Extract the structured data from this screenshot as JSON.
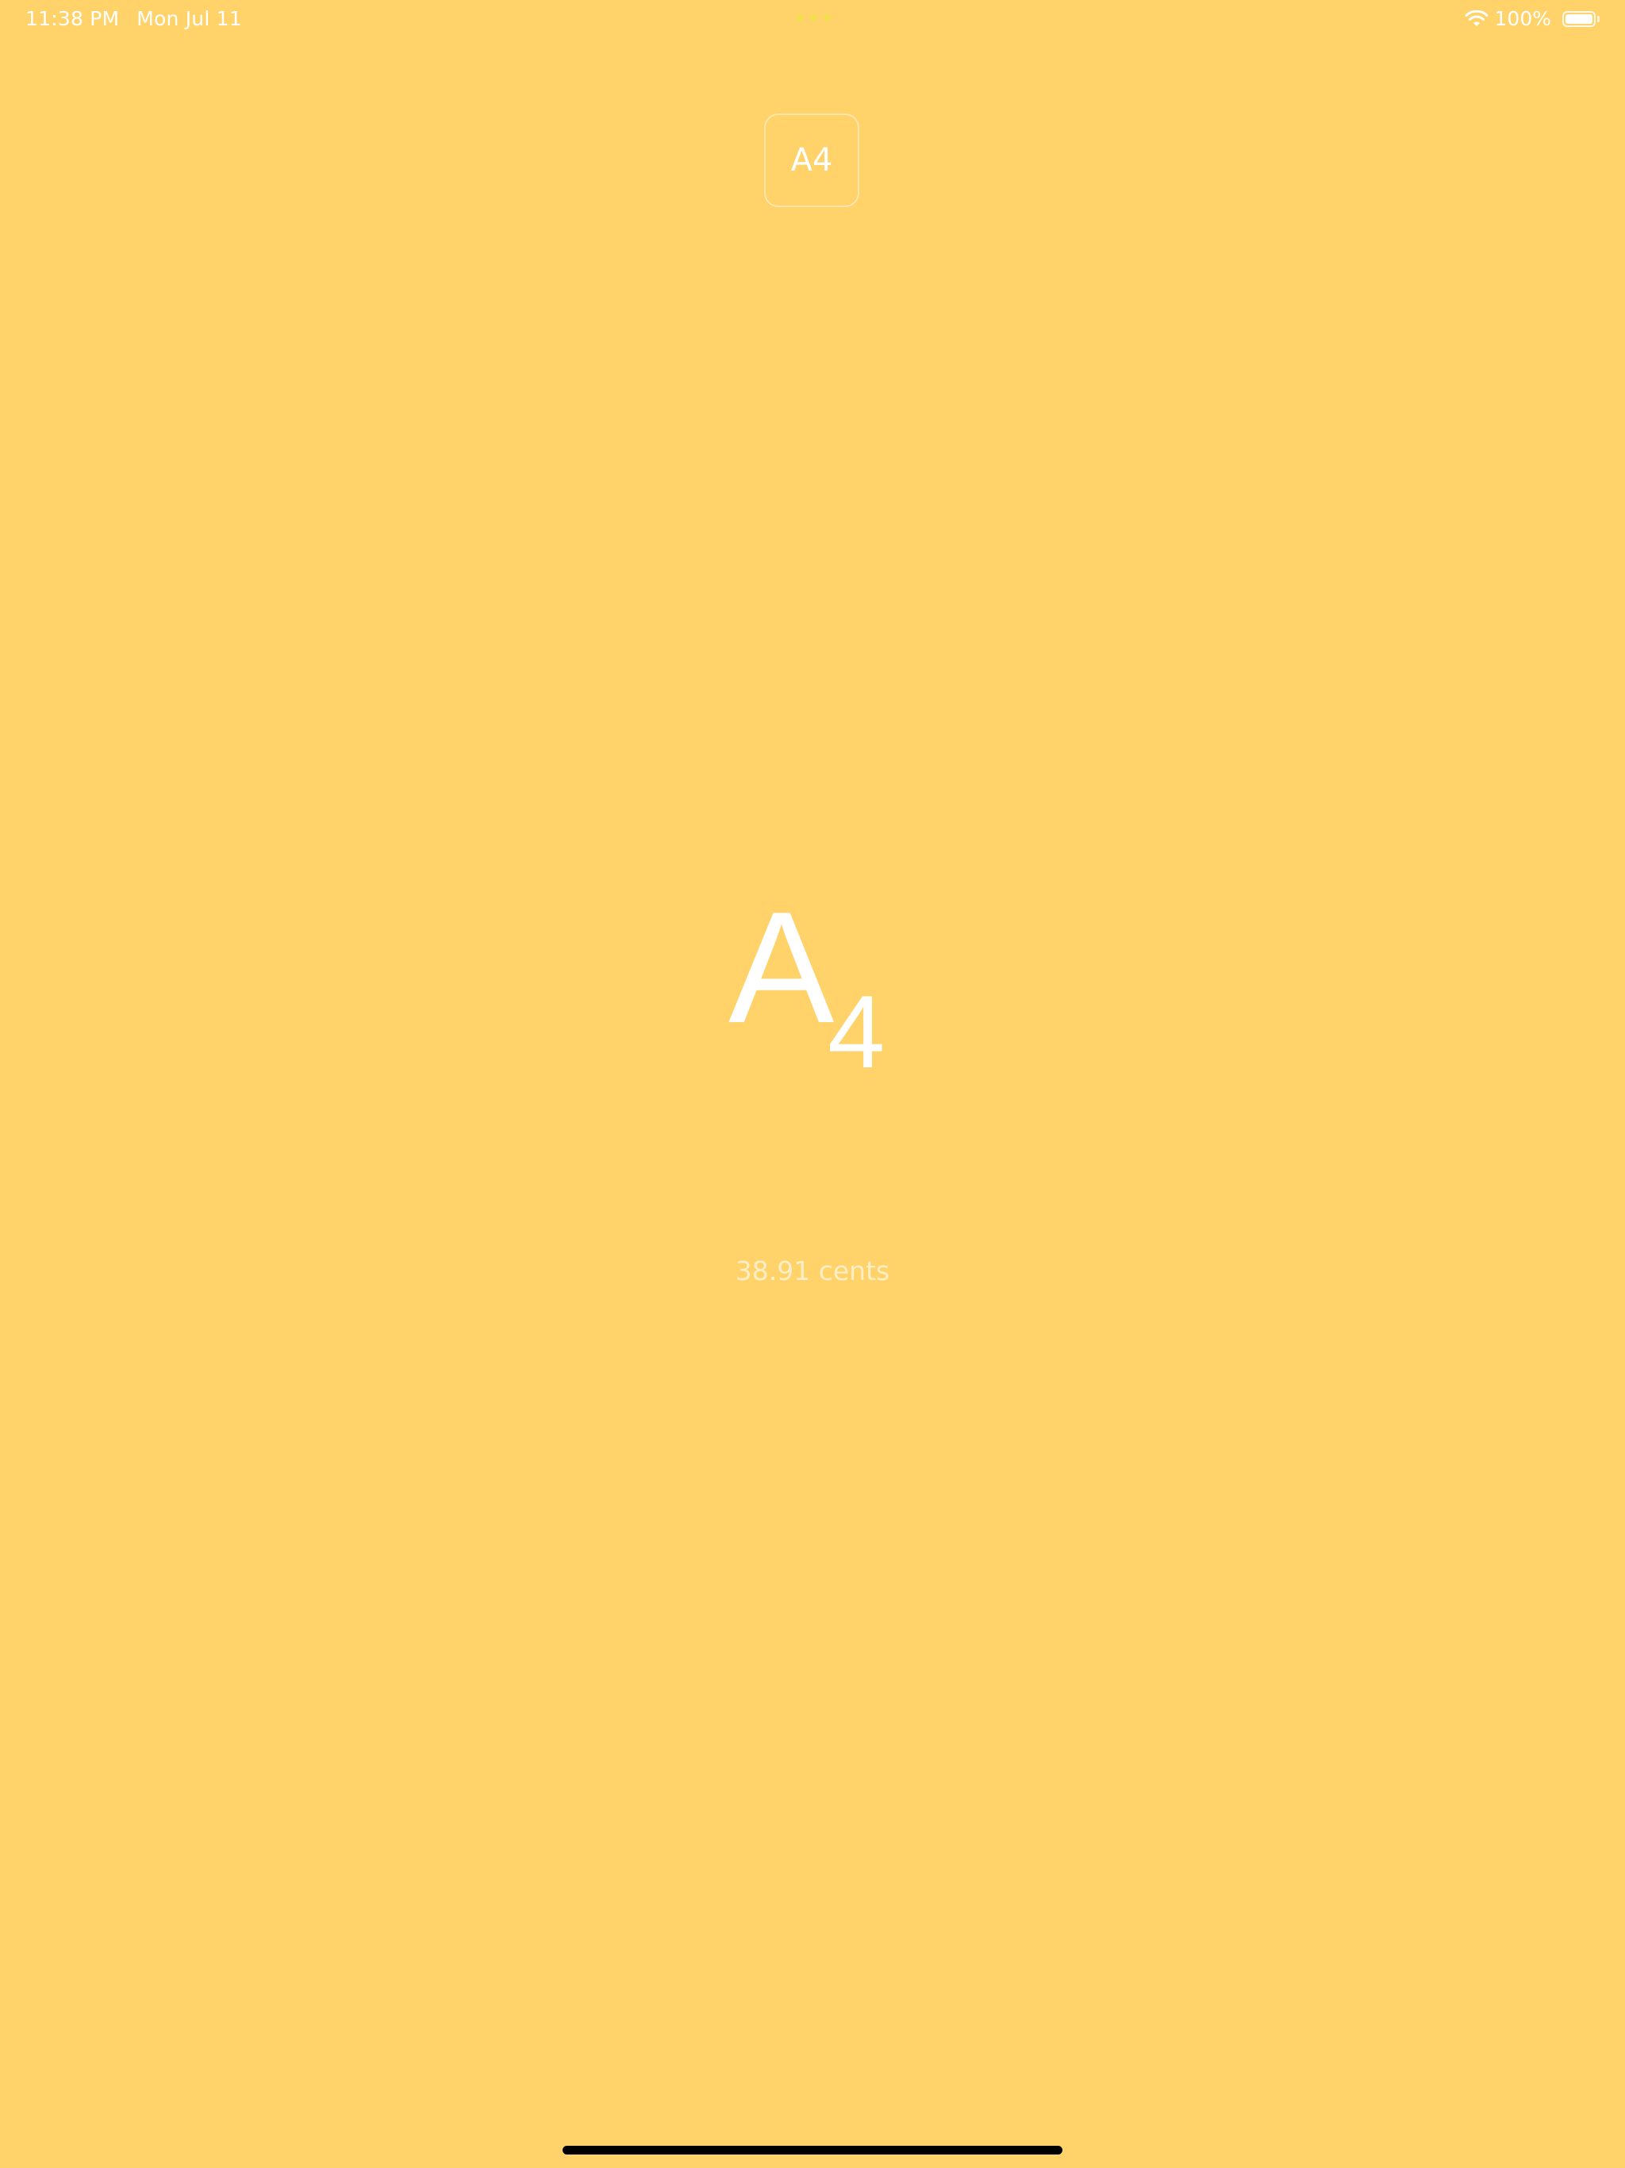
{
  "status_bar": {
    "time": "11:38 PM",
    "date": "Mon Jul 11",
    "battery_text": "100%",
    "battery_level": 1.0,
    "icons": [
      "wifi-icon",
      "battery-icon"
    ]
  },
  "note_picker": {
    "label": "A4"
  },
  "note_display": {
    "letter": "A",
    "octave": "4"
  },
  "cents": {
    "text": "38.91 cents"
  },
  "colors": {
    "background": "#FFD26A",
    "text": "#FFFFFF",
    "multitask_dots": "#F3DE4E"
  }
}
